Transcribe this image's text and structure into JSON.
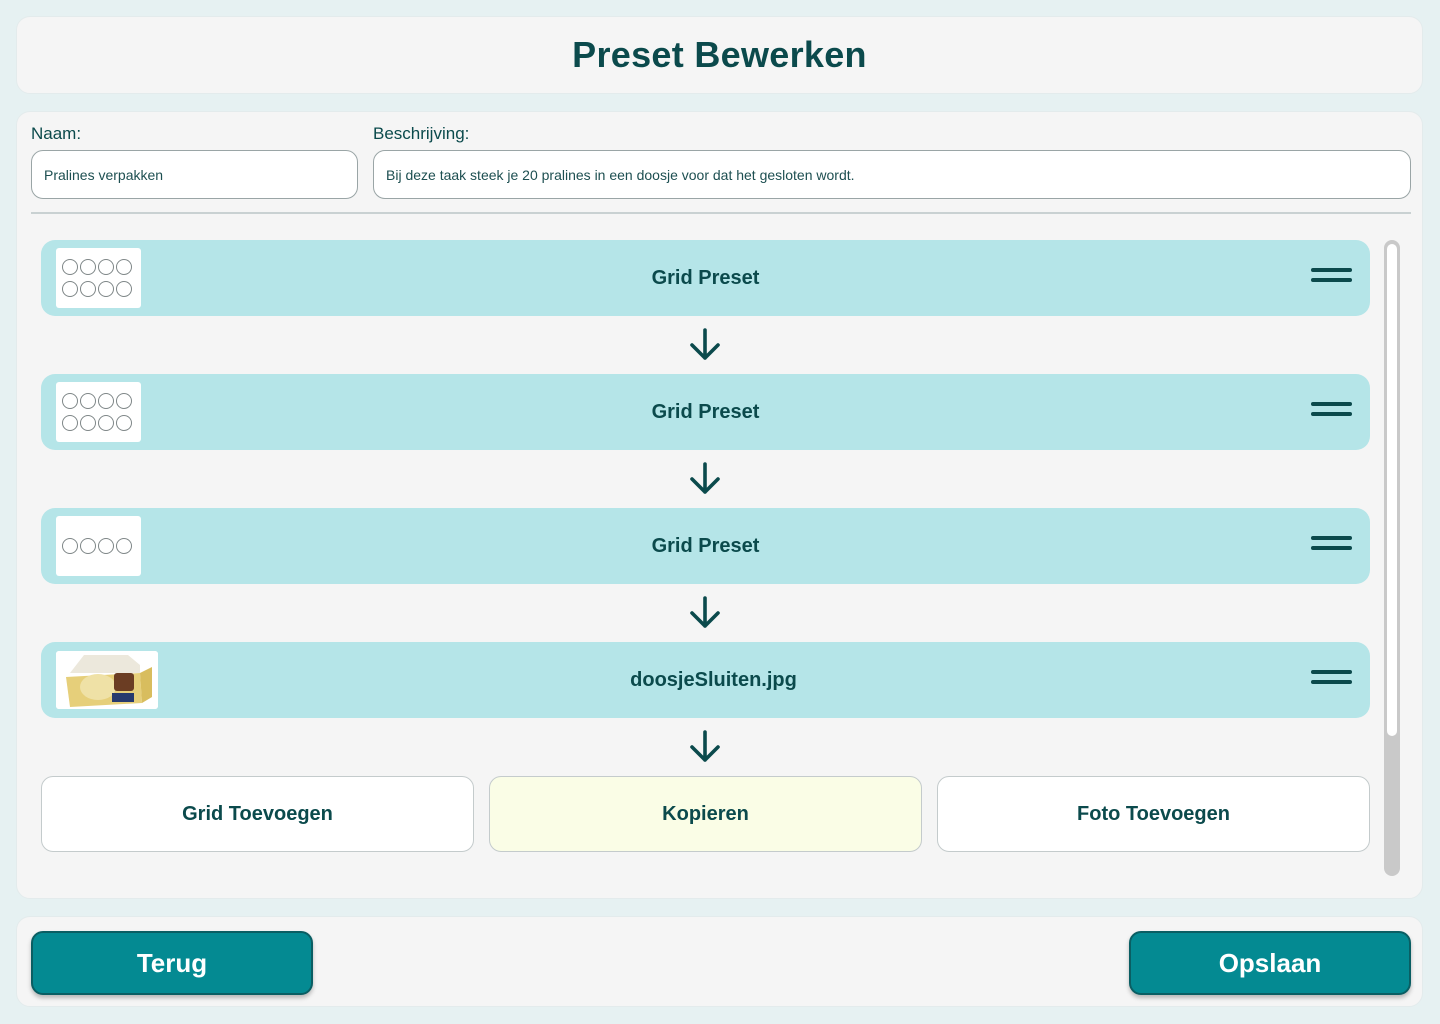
{
  "header": {
    "title": "Preset Bewerken"
  },
  "form": {
    "name_label": "Naam:",
    "name_value": "Pralines verpakken",
    "description_label": "Beschrijving:",
    "description_value": "Bij deze taak steek je 20 pralines in een doosje voor dat het gesloten wordt."
  },
  "steps": [
    {
      "title": "Grid Preset",
      "type": "grid",
      "grid_rows": 2,
      "grid_cols": 4
    },
    {
      "title": "Grid Preset",
      "type": "grid",
      "grid_rows": 2,
      "grid_cols": 4
    },
    {
      "title": "Grid Preset",
      "type": "grid",
      "grid_rows": 1,
      "grid_cols": 4
    },
    {
      "title": "doosjeSluiten.jpg",
      "type": "photo"
    }
  ],
  "actions": {
    "add_grid": "Grid Toevoegen",
    "copy": "Kopieren",
    "add_photo": "Foto Toevoegen"
  },
  "footer": {
    "back": "Terug",
    "save": "Opslaan"
  },
  "colors": {
    "primary": "#048a92",
    "step_background": "#b5e5e8",
    "text": "#0b4a4c",
    "copy_highlight": "#fafde6"
  },
  "icons": {
    "step_connector": "arrow-down-icon",
    "reorder": "drag-handle-icon"
  }
}
